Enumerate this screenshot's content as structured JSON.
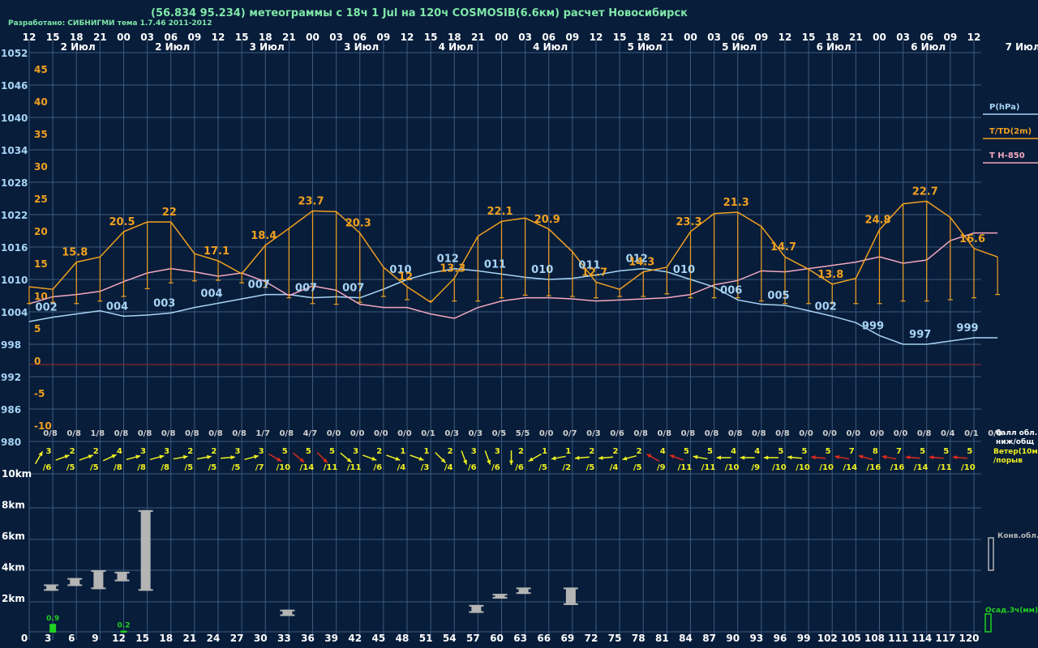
{
  "header": {
    "title": "(56.834 95.234) метеограммы с  18ч 1 Jul на 120ч COSMOSIB(6.6км) расчет Новосибирск",
    "credit": "Разработано: СИБНИГМИ тема 1.7.46 2011-2012"
  },
  "colors": {
    "background": "#071d3a",
    "grid": "#3e5a7e",
    "pressure": "#a8d4f4",
    "temperature": "#f0a020",
    "t850": "#f4a8c0",
    "wind_arrow": "#f0f020",
    "wind_arrow_strong": "#e02a1a",
    "cloud_bar": "#b4b4b4",
    "precip_bar": "#20d020",
    "zero_line": "#a02a2a"
  },
  "chart_data": {
    "type": "line",
    "hour_labels": [
      "12",
      "15",
      "18",
      "21",
      "00",
      "03",
      "06",
      "09",
      "12",
      "15",
      "18",
      "21",
      "00",
      "03",
      "06",
      "09",
      "12",
      "15",
      "18",
      "21",
      "00",
      "03",
      "06",
      "09",
      "12",
      "15",
      "18",
      "21",
      "00",
      "03",
      "06",
      "09",
      "12",
      "15",
      "18",
      "21",
      "00",
      "03",
      "06",
      "09",
      "12"
    ],
    "date_labels": [
      {
        "text": "2 Июл",
        "col": 1
      },
      {
        "text": "2 Июл",
        "col": 5
      },
      {
        "text": "3 Июл",
        "col": 9
      },
      {
        "text": "3 Июл",
        "col": 13
      },
      {
        "text": "4 Июл",
        "col": 17
      },
      {
        "text": "4 Июл",
        "col": 21
      },
      {
        "text": "5 Июл",
        "col": 25
      },
      {
        "text": "5 Июл",
        "col": 29
      },
      {
        "text": "6 Июл",
        "col": 33
      },
      {
        "text": "6 Июл",
        "col": 37
      },
      {
        "text": "7 Июл",
        "col": 41
      }
    ],
    "pressure_ticks": [
      "1052",
      "1046",
      "1040",
      "1034",
      "1028",
      "1022",
      "1016",
      "1010",
      "1004",
      "998",
      "992",
      "986",
      "980"
    ],
    "temp_ticks": [
      "45",
      "40",
      "35",
      "30",
      "25",
      "20",
      "15",
      "10",
      "5",
      "0",
      "-5",
      "-10"
    ],
    "height_ticks": [
      "10km",
      "8km",
      "6km",
      "4km",
      "2km"
    ],
    "forecast_hours": [
      "0",
      "3",
      "6",
      "9",
      "12",
      "15",
      "18",
      "21",
      "24",
      "27",
      "30",
      "33",
      "36",
      "39",
      "42",
      "45",
      "48",
      "51",
      "54",
      "57",
      "60",
      "63",
      "66",
      "69",
      "72",
      "75",
      "78",
      "81",
      "84",
      "87",
      "90",
      "93",
      "96",
      "99",
      "102",
      "105",
      "108",
      "111",
      "114",
      "117",
      "120"
    ],
    "legend": [
      "P(hPa)",
      "T/TD(2m)",
      "T H-850"
    ],
    "side_labels": {
      "cloud": "балл обл.\nниж/общ",
      "wind": "Ветер(10м)\n/порыв",
      "conv": "Конв.обл.",
      "precip": "Осад.3ч(мм)"
    },
    "series": [
      {
        "name": "P(hPa)",
        "values": [
          1002.2,
          1003,
          1003.6,
          1004.2,
          1003.2,
          1003.4,
          1003.8,
          1004.8,
          1005.6,
          1006.4,
          1007.2,
          1007.2,
          1006.6,
          1006.8,
          1006.6,
          1008.2,
          1010,
          1011.2,
          1012,
          1011.6,
          1011,
          1010.4,
          1010,
          1010.2,
          1010.8,
          1011.6,
          1012,
          1011.4,
          1010,
          1008.6,
          1006.2,
          1005.4,
          1005.2,
          1004.2,
          1003.2,
          1002,
          999.6,
          998,
          998,
          998.6,
          999.2,
          999.2
        ]
      },
      {
        "name": "T/TD(2m)",
        "values": [
          12,
          11.6,
          15.8,
          16.6,
          20.5,
          22,
          22,
          17.1,
          16,
          14,
          18.4,
          21,
          23.7,
          23.6,
          20.3,
          15,
          12,
          9.6,
          13.3,
          19.8,
          22.1,
          22.6,
          20.9,
          17.4,
          12.7,
          11.6,
          14.3,
          15,
          20.5,
          23.3,
          23.5,
          21.3,
          16.6,
          14.7,
          12.4,
          13.3,
          20.8,
          24.8,
          25.2,
          22.7,
          17.9,
          16.6
        ]
      },
      {
        "name": "TD",
        "values": [
          9.4,
          9.6,
          9.4,
          9.8,
          10.5,
          11.7,
          12.6,
          12.9,
          13,
          12.6,
          11.9,
          10.3,
          9.4,
          9.3,
          9.6,
          10.5,
          10,
          9.8,
          9.8,
          9.8,
          10.3,
          10.7,
          10.6,
          10.5,
          10.3,
          10.5,
          10.5,
          10.9,
          10.3,
          10.3,
          10.3,
          9.8,
          9.4,
          9.4,
          9.4,
          9.4,
          9.4,
          9.8,
          9.8,
          10,
          10.3,
          10.8
        ]
      },
      {
        "name": "T H-850",
        "values": [
          1005.5,
          1006.8,
          1007.2,
          1007.8,
          1009.6,
          1011.2,
          1012,
          1011.4,
          1010.6,
          1011.2,
          1009.6,
          1007,
          1008.8,
          1008,
          1005.4,
          1004.8,
          1004.8,
          1003.6,
          1002.8,
          1004.8,
          1006,
          1006.6,
          1006.6,
          1006.4,
          1006,
          1006.2,
          1006.4,
          1006.6,
          1007.2,
          1009,
          1009.8,
          1011.6,
          1011.4,
          1012,
          1012.6,
          1013.2,
          1014.2,
          1013,
          1013.6,
          1017.2,
          1018.6,
          1018.6
        ]
      }
    ],
    "pressure_labels": [
      {
        "i": 1,
        "text": "002"
      },
      {
        "i": 4,
        "text": "004"
      },
      {
        "i": 6,
        "text": "003"
      },
      {
        "i": 8,
        "text": "004"
      },
      {
        "i": 10,
        "text": "007"
      },
      {
        "i": 12,
        "text": "007"
      },
      {
        "i": 14,
        "text": "007"
      },
      {
        "i": 16,
        "text": "010"
      },
      {
        "i": 18,
        "text": "012"
      },
      {
        "i": 20,
        "text": "011"
      },
      {
        "i": 22,
        "text": "010"
      },
      {
        "i": 24,
        "text": "011"
      },
      {
        "i": 26,
        "text": "012"
      },
      {
        "i": 28,
        "text": "010"
      },
      {
        "i": 30,
        "text": "006"
      },
      {
        "i": 32,
        "text": "005"
      },
      {
        "i": 34,
        "text": "002"
      },
      {
        "i": 36,
        "text": "999"
      },
      {
        "i": 38,
        "text": "997"
      },
      {
        "i": 40,
        "text": "999"
      }
    ],
    "temp_labels": [
      {
        "i": 2,
        "text": "15.8"
      },
      {
        "i": 4,
        "text": "20.5"
      },
      {
        "i": 6,
        "text": "22"
      },
      {
        "i": 8,
        "text": "17.1"
      },
      {
        "i": 10,
        "text": "18.4"
      },
      {
        "i": 12,
        "text": "23.7"
      },
      {
        "i": 14,
        "text": "20.3"
      },
      {
        "i": 16,
        "text": "12"
      },
      {
        "i": 18,
        "text": "13.3"
      },
      {
        "i": 20,
        "text": "22.1"
      },
      {
        "i": 22,
        "text": "20.9"
      },
      {
        "i": 24,
        "text": "12.7"
      },
      {
        "i": 26,
        "text": "14.3"
      },
      {
        "i": 28,
        "text": "23.3"
      },
      {
        "i": 30,
        "text": "21.3"
      },
      {
        "i": 32,
        "text": "14.7"
      },
      {
        "i": 34,
        "text": "13.8"
      },
      {
        "i": 36,
        "text": "24.8"
      },
      {
        "i": 38,
        "text": "22.7"
      },
      {
        "i": 40,
        "text": "16.6"
      }
    ],
    "cloud_cover": [
      "0/8",
      "0/8",
      "1/8",
      "0/8",
      "0/8",
      "0/8",
      "0/8",
      "0/8",
      "0/8",
      "1/7",
      "0/8",
      "4/7",
      "0/0",
      "0/0",
      "0/0",
      "0/0",
      "0/1",
      "0/3",
      "0/3",
      "0/5",
      "5/5",
      "0/0",
      "0/7",
      "0/3",
      "0/6",
      "0/8",
      "0/8",
      "0/8",
      "0/8",
      "0/8",
      "0/8",
      "0/8",
      "0/0",
      "0/0",
      "0/0",
      "0/0",
      "0/0",
      "0/8",
      "0/4",
      "0/1",
      "0/0"
    ],
    "wind": [
      {
        "s": "3",
        "g": "/6",
        "dir": 60
      },
      {
        "s": "2",
        "g": "/5",
        "dir": 20
      },
      {
        "s": "2",
        "g": "/5",
        "dir": 20
      },
      {
        "s": "4",
        "g": "/8",
        "dir": 25
      },
      {
        "s": "3",
        "g": "/8",
        "dir": 15
      },
      {
        "s": "3",
        "g": "/8",
        "dir": 15
      },
      {
        "s": "2",
        "g": "/5",
        "dir": 10
      },
      {
        "s": "2",
        "g": "/5",
        "dir": 10
      },
      {
        "s": "3",
        "g": "/5",
        "dir": 5
      },
      {
        "s": "3",
        "g": "/7",
        "dir": 15
      },
      {
        "s": "5",
        "g": "/10",
        "dir": -30,
        "strong": true
      },
      {
        "s": "5",
        "g": "/14",
        "dir": -40,
        "strong": true
      },
      {
        "s": "5",
        "g": "/11",
        "dir": -45,
        "strong": true
      },
      {
        "s": "3",
        "g": "/11",
        "dir": -40
      },
      {
        "s": "2",
        "g": "/6",
        "dir": -20
      },
      {
        "s": "1",
        "g": "/4",
        "dir": -20
      },
      {
        "s": "1",
        "g": "/3",
        "dir": -20
      },
      {
        "s": "2",
        "g": "/4",
        "dir": -45
      },
      {
        "s": "3",
        "g": "/6",
        "dir": -70
      },
      {
        "s": "3",
        "g": "/6",
        "dir": -70
      },
      {
        "s": "2",
        "g": "/6",
        "dir": -90
      },
      {
        "s": "1",
        "g": "/5",
        "dir": -150
      },
      {
        "s": "1",
        "g": "/2",
        "dir": -170
      },
      {
        "s": "2",
        "g": "/5",
        "dir": -175
      },
      {
        "s": "2",
        "g": "/4",
        "dir": -175
      },
      {
        "s": "2",
        "g": "/5",
        "dir": -165
      },
      {
        "s": "4",
        "g": "/9",
        "dir": 150,
        "strong": true
      },
      {
        "s": "5",
        "g": "/11",
        "dir": 160,
        "strong": true
      },
      {
        "s": "5",
        "g": "/11",
        "dir": 170
      },
      {
        "s": "4",
        "g": "/10",
        "dir": 180
      },
      {
        "s": "4",
        "g": "/9",
        "dir": 180
      },
      {
        "s": "5",
        "g": "/10",
        "dir": 180
      },
      {
        "s": "5",
        "g": "/10",
        "dir": 175
      },
      {
        "s": "5",
        "g": "/10",
        "dir": 175,
        "strong": true
      },
      {
        "s": "7",
        "g": "/14",
        "dir": 170,
        "strong": true
      },
      {
        "s": "8",
        "g": "/16",
        "dir": 165,
        "strong": true
      },
      {
        "s": "7",
        "g": "/16",
        "dir": 170,
        "strong": true
      },
      {
        "s": "5",
        "g": "/14",
        "dir": 175,
        "strong": true
      },
      {
        "s": "5",
        "g": "/11",
        "dir": 175,
        "strong": true
      },
      {
        "s": "5",
        "g": "/10",
        "dir": 175,
        "strong": true
      }
    ],
    "convective_clouds": [
      {
        "i": 1,
        "bottom": 2.6,
        "top": 3.0
      },
      {
        "i": 2,
        "bottom": 2.9,
        "top": 3.4
      },
      {
        "i": 3,
        "bottom": 2.7,
        "top": 3.9
      },
      {
        "i": 4,
        "bottom": 3.2,
        "top": 3.8
      },
      {
        "i": 5,
        "bottom": 2.6,
        "top": 7.7
      },
      {
        "i": 11,
        "bottom": 1.0,
        "top": 1.4
      },
      {
        "i": 19,
        "bottom": 1.2,
        "top": 1.7
      },
      {
        "i": 20,
        "bottom": 2.1,
        "top": 2.4
      },
      {
        "i": 21,
        "bottom": 2.4,
        "top": 2.8
      },
      {
        "i": 23,
        "bottom": 1.7,
        "top": 2.8
      }
    ],
    "precipitation": [
      {
        "i": 1,
        "value": 0.9,
        "text": "0.9"
      },
      {
        "i": 4,
        "value": 0.2,
        "text": "0.2"
      }
    ],
    "ylim_pressure": [
      980,
      1052
    ],
    "ylim_temperature": [
      -12.5,
      53.8
    ],
    "height_range_km": [
      0,
      10
    ],
    "grid": true,
    "legend_position": "right"
  }
}
